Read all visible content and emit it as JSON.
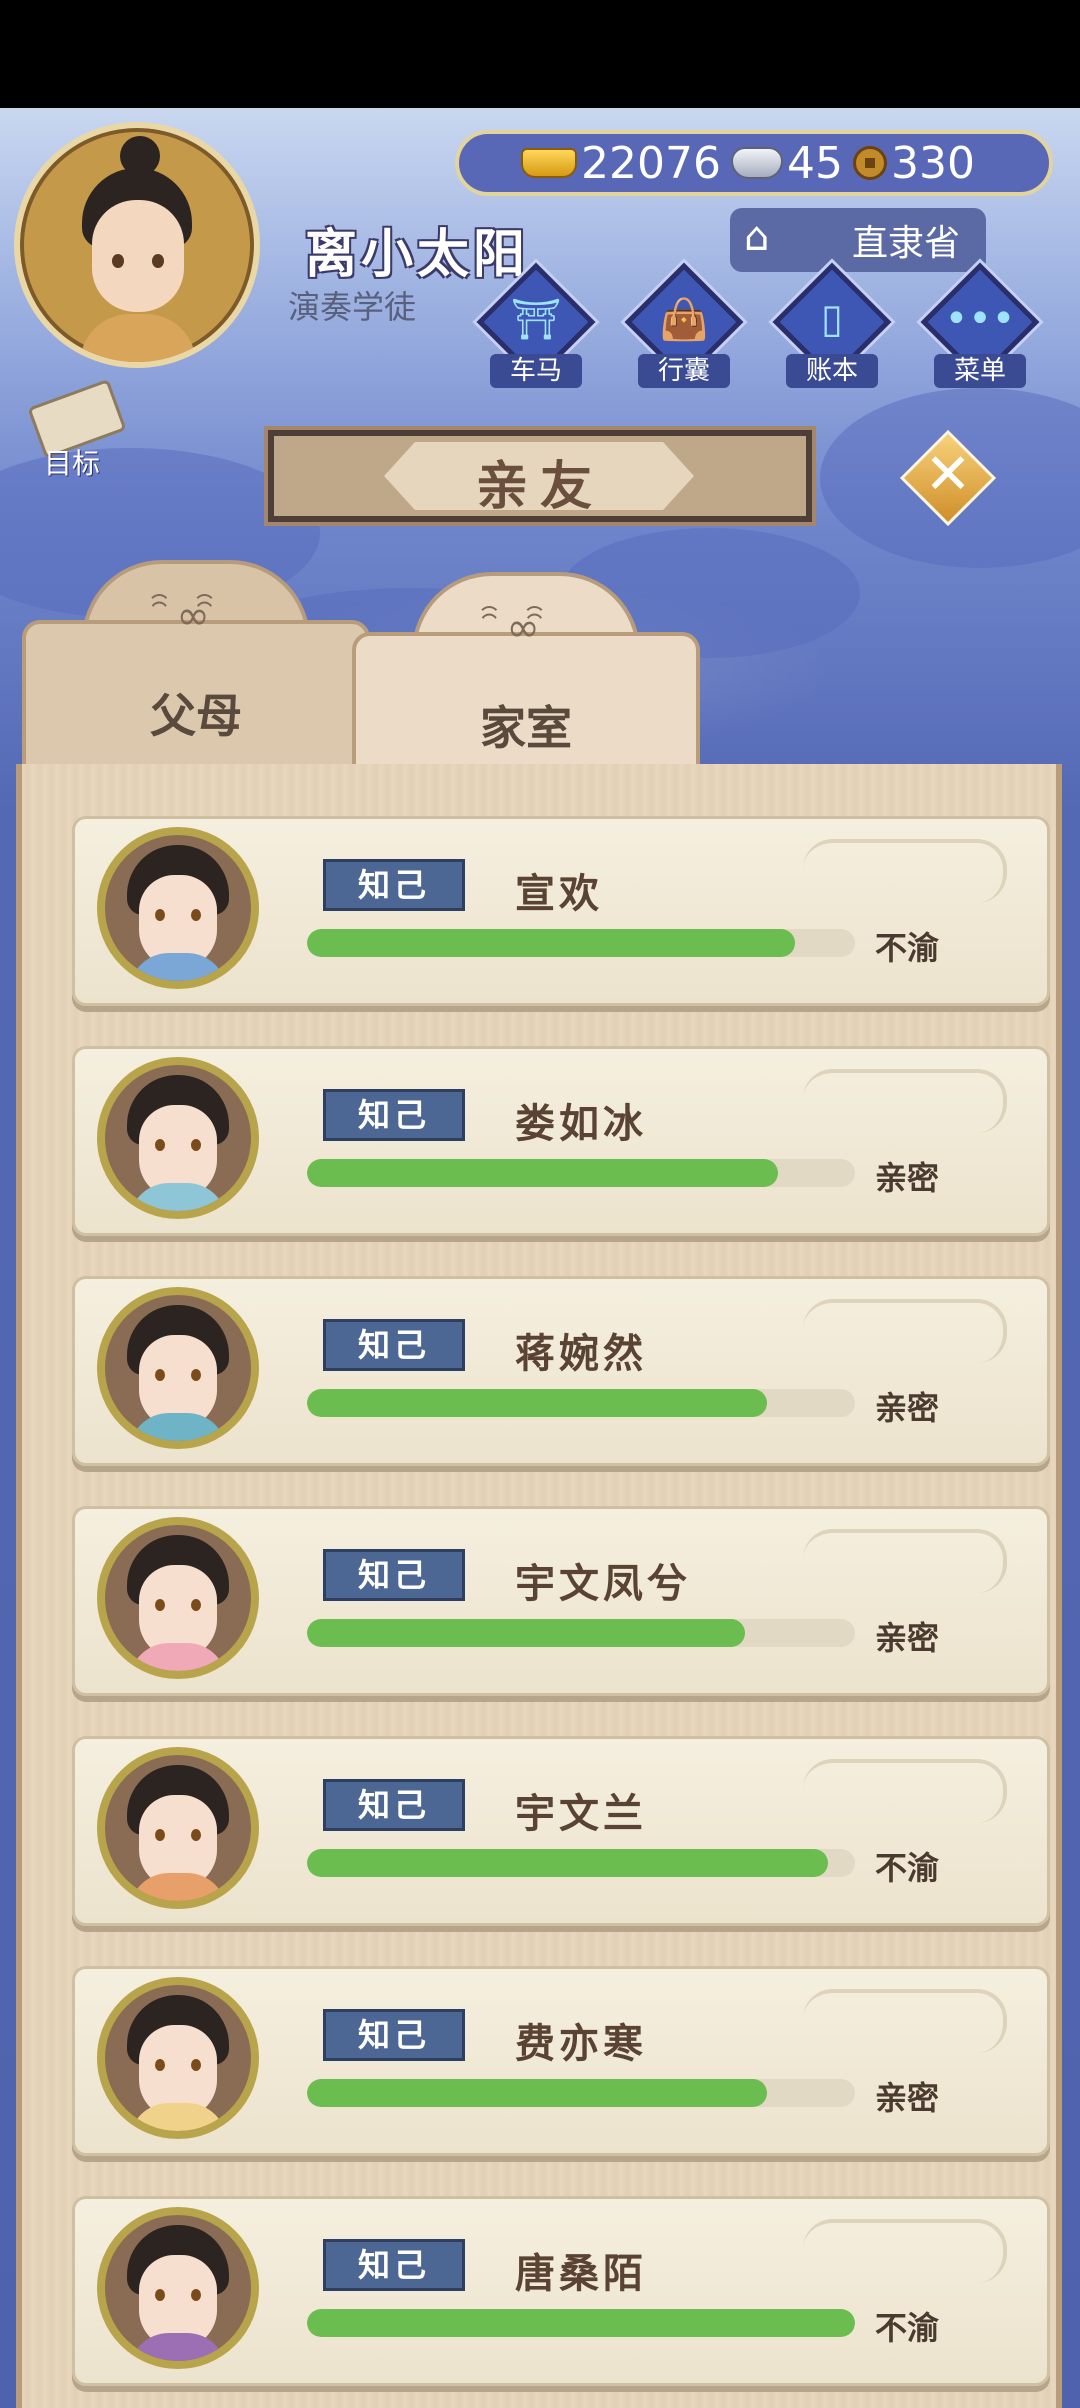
{
  "player": {
    "name": "离小太阳",
    "title": "演奏学徒"
  },
  "currency": {
    "gold": "22076",
    "silver": "45",
    "coins": "330"
  },
  "region": "直隶省",
  "menu": [
    {
      "label": "车马"
    },
    {
      "label": "行囊"
    },
    {
      "label": "账本"
    },
    {
      "label": "菜单"
    }
  ],
  "goal_label": "目标",
  "header": "亲友",
  "tabs": [
    {
      "label": "父母",
      "active": false
    },
    {
      "label": "家室",
      "active": true
    }
  ],
  "relations": [
    {
      "badge": "知己",
      "name": "宣欢",
      "status": "不渝",
      "progress": 0.89,
      "robe": "#7aa7d6"
    },
    {
      "badge": "知己",
      "name": "娄如冰",
      "status": "亲密",
      "progress": 0.86,
      "robe": "#8ec6d8"
    },
    {
      "badge": "知己",
      "name": "蒋婉然",
      "status": "亲密",
      "progress": 0.84,
      "robe": "#6fb3c7"
    },
    {
      "badge": "知己",
      "name": "宇文凤兮",
      "status": "亲密",
      "progress": 0.8,
      "robe": "#f0a9b6"
    },
    {
      "badge": "知己",
      "name": "宇文兰",
      "status": "不渝",
      "progress": 0.95,
      "robe": "#e8a06b"
    },
    {
      "badge": "知己",
      "name": "费亦寒",
      "status": "亲密",
      "progress": 0.84,
      "robe": "#f1d28b"
    },
    {
      "badge": "知己",
      "name": "唐桑陌",
      "status": "不渝",
      "progress": 1.0,
      "robe": "#9c6fb4"
    }
  ],
  "colors": {
    "bar_fill": "#6cbd4f",
    "badge": "#4d6795",
    "card": "#f5efdf"
  }
}
